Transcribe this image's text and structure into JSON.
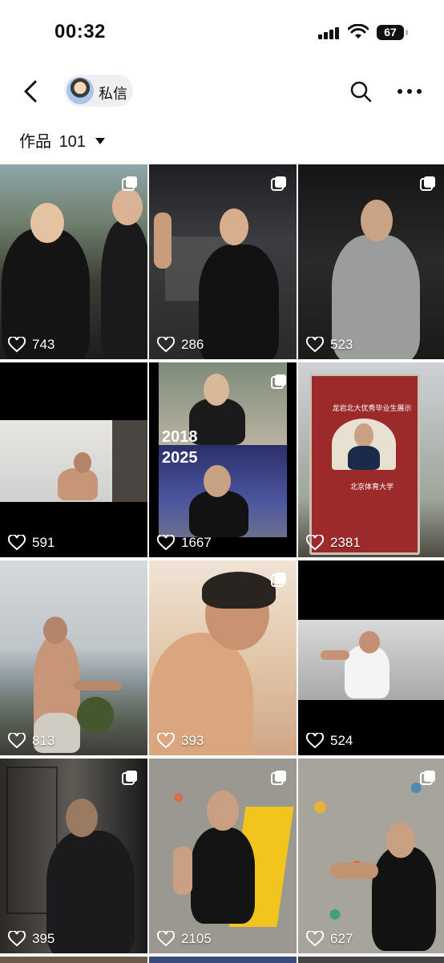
{
  "status_bar": {
    "time": "00:32",
    "battery": "67"
  },
  "nav": {
    "chat_label": "私信"
  },
  "works": {
    "label": "作品",
    "count": "101"
  },
  "tiles": [
    {
      "likes": "743"
    },
    {
      "likes": "286"
    },
    {
      "likes": "523"
    },
    {
      "likes": "591"
    },
    {
      "likes": "1667",
      "year_top": "2018",
      "year_bottom": "2025"
    },
    {
      "likes": "2381",
      "sign_title": "龙岩北大优秀毕业生展示",
      "sign_school": "北京体育大学"
    },
    {
      "likes": "813"
    },
    {
      "likes": "393"
    },
    {
      "likes": "524"
    },
    {
      "likes": "395"
    },
    {
      "likes": "2105"
    },
    {
      "likes": "627"
    }
  ]
}
